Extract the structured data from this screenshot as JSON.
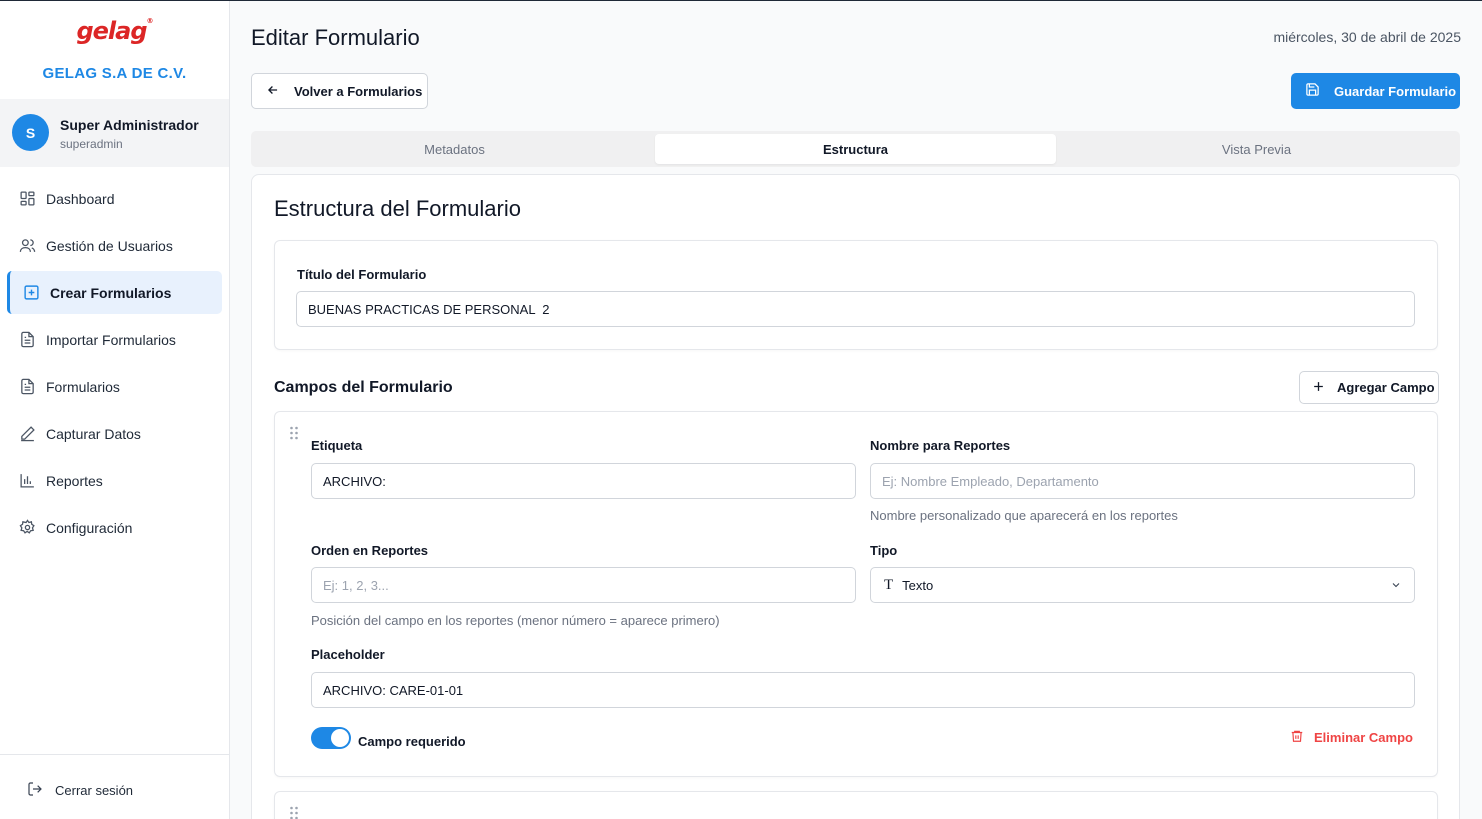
{
  "sidebar": {
    "logo": "gelag",
    "logo_mark": "®",
    "company": "GELAG S.A DE C.V.",
    "user": {
      "initial": "S",
      "name": "Super Administrador",
      "login": "superadmin"
    },
    "items": [
      {
        "label": "Dashboard",
        "icon": "dashboard-icon"
      },
      {
        "label": "Gestión de Usuarios",
        "icon": "users-icon"
      },
      {
        "label": "Crear Formularios",
        "icon": "plus-square-icon",
        "active": true
      },
      {
        "label": "Importar Formularios",
        "icon": "file-text-icon"
      },
      {
        "label": "Formularios",
        "icon": "file-text-icon"
      },
      {
        "label": "Capturar Datos",
        "icon": "pencil-icon"
      },
      {
        "label": "Reportes",
        "icon": "bar-chart-icon"
      },
      {
        "label": "Configuración",
        "icon": "gear-icon"
      }
    ],
    "logout": "Cerrar sesión"
  },
  "header": {
    "title": "Editar Formulario",
    "date": "miércoles, 30 de abril de 2025",
    "back_label": "Volver a Formularios",
    "save_label": "Guardar Formulario"
  },
  "tabs": [
    {
      "label": "Metadatos"
    },
    {
      "label": "Estructura",
      "active": true
    },
    {
      "label": "Vista Previa"
    }
  ],
  "structure": {
    "title": "Estructura del Formulario",
    "form_title_label": "Título del Formulario",
    "form_title_value": "BUENAS PRACTICAS DE PERSONAL  2",
    "fields_title": "Campos del Formulario",
    "add_field_label": "Agregar Campo",
    "field": {
      "label_label": "Etiqueta",
      "label_value": "ARCHIVO:",
      "report_name_label": "Nombre para Reportes",
      "report_name_placeholder": "Ej: Nombre Empleado, Departamento",
      "report_name_hint": "Nombre personalizado que aparecerá en los reportes",
      "order_label": "Orden en Reportes",
      "order_placeholder": "Ej: 1, 2, 3...",
      "order_hint": "Posición del campo en los reportes (menor número = aparece primero)",
      "type_label": "Tipo",
      "type_value": "Texto",
      "placeholder_label": "Placeholder",
      "placeholder_value": "ARCHIVO: CARE-01-01",
      "required_label": "Campo requerido",
      "required": true,
      "delete_label": "Eliminar Campo"
    }
  },
  "colors": {
    "accent": "#1e88e5",
    "danger": "#ef4444",
    "brand": "#dc2626"
  }
}
